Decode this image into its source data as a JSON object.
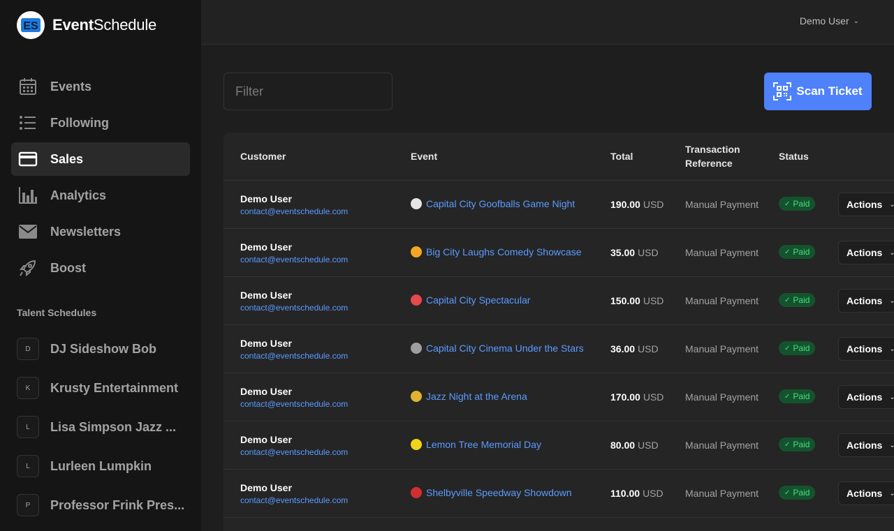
{
  "brand": {
    "name_bold": "Event",
    "name_regular": "Schedule",
    "logo_letters": "ES"
  },
  "nav": [
    {
      "label": "Events",
      "icon": "calendar-icon",
      "active": false
    },
    {
      "label": "Following",
      "icon": "list-icon",
      "active": false
    },
    {
      "label": "Sales",
      "icon": "credit-card-icon",
      "active": true
    },
    {
      "label": "Analytics",
      "icon": "bar-chart-icon",
      "active": false
    },
    {
      "label": "Newsletters",
      "icon": "envelope-icon",
      "active": false
    },
    {
      "label": "Boost",
      "icon": "rocket-icon",
      "active": false
    }
  ],
  "talent_section": {
    "title": "Talent Schedules",
    "items": [
      {
        "initial": "D",
        "name": "DJ Sideshow Bob"
      },
      {
        "initial": "K",
        "name": "Krusty Entertainment"
      },
      {
        "initial": "L",
        "name": "Lisa Simpson Jazz ..."
      },
      {
        "initial": "L",
        "name": "Lurleen Lumpkin"
      },
      {
        "initial": "P",
        "name": "Professor Frink Pres..."
      }
    ]
  },
  "header": {
    "user_name": "Demo User"
  },
  "toolbar": {
    "filter_placeholder": "Filter",
    "scan_label": "Scan Ticket"
  },
  "table": {
    "columns": {
      "customer": "Customer",
      "event": "Event",
      "total": "Total",
      "ref_line1": "Transaction",
      "ref_line2": "Reference",
      "status": "Status"
    },
    "rows": [
      {
        "name": "Demo User",
        "email": "contact@eventschedule.com",
        "event": "Capital City Goofballs Game Night",
        "emoji_color": "#e5e5e5",
        "amount": "190.00",
        "currency": "USD",
        "ref": "Manual Payment",
        "status": "Paid",
        "action": "Actions"
      },
      {
        "name": "Demo User",
        "email": "contact@eventschedule.com",
        "event": "Big City Laughs Comedy Showcase",
        "emoji_color": "#f5a623",
        "amount": "35.00",
        "currency": "USD",
        "ref": "Manual Payment",
        "status": "Paid",
        "action": "Actions"
      },
      {
        "name": "Demo User",
        "email": "contact@eventschedule.com",
        "event": "Capital City Spectacular",
        "emoji_color": "#e5484d",
        "amount": "150.00",
        "currency": "USD",
        "ref": "Manual Payment",
        "status": "Paid",
        "action": "Actions"
      },
      {
        "name": "Demo User",
        "email": "contact@eventschedule.com",
        "event": "Capital City Cinema Under the Stars",
        "emoji_color": "#9e9e9e",
        "amount": "36.00",
        "currency": "USD",
        "ref": "Manual Payment",
        "status": "Paid",
        "action": "Actions"
      },
      {
        "name": "Demo User",
        "email": "contact@eventschedule.com",
        "event": "Jazz Night at the Arena",
        "emoji_color": "#e0b431",
        "amount": "170.00",
        "currency": "USD",
        "ref": "Manual Payment",
        "status": "Paid",
        "action": "Actions"
      },
      {
        "name": "Demo User",
        "email": "contact@eventschedule.com",
        "event": "Lemon Tree Memorial Day",
        "emoji_color": "#f2d21b",
        "amount": "80.00",
        "currency": "USD",
        "ref": "Manual Payment",
        "status": "Paid",
        "action": "Actions"
      },
      {
        "name": "Demo User",
        "email": "contact@eventschedule.com",
        "event": "Shelbyville Speedway Showdown",
        "emoji_color": "#d32f2f",
        "amount": "110.00",
        "currency": "USD",
        "ref": "Manual Payment",
        "status": "Paid",
        "action": "Actions"
      }
    ]
  },
  "colors": {
    "accent": "#4e81fa",
    "link": "#5b9bff",
    "paid_bg": "#14532d",
    "paid_text": "#4ade80"
  }
}
